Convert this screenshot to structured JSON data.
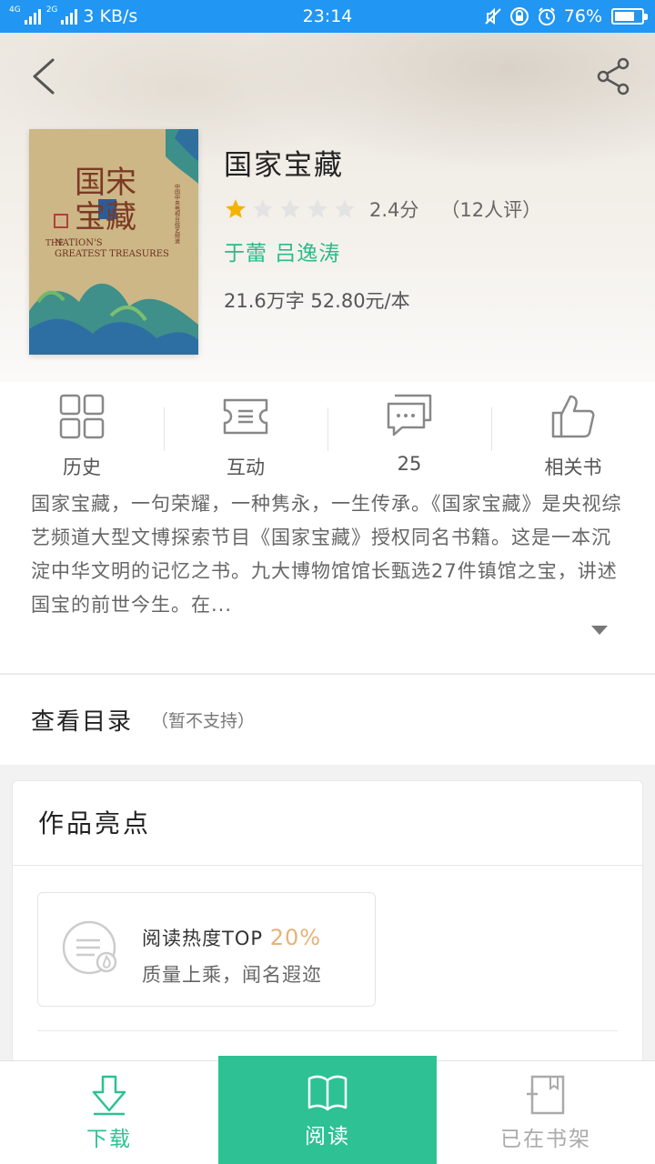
{
  "status_bar": {
    "network_1": "4G",
    "network_2": "2G",
    "speed": "3 KB/s",
    "time": "23:14",
    "battery": "76%",
    "battery_level": 0.76
  },
  "header": {
    "back_icon": "chevron-left-icon",
    "share_icon": "share-icon"
  },
  "book": {
    "cover_title_cn": "国家宝藏",
    "cover_title_en": "NATION'S GREATEST TREASURES",
    "title": "国家宝藏",
    "rating_score": "2.4分",
    "rating_stars": 1,
    "rating_max": 5,
    "review_count": "（12人评）",
    "authors": "于蕾 吕逸涛",
    "meta": "21.6万字 52.80元/本"
  },
  "actions": [
    {
      "label": "历史",
      "icon": "grid-icon"
    },
    {
      "label": "互动",
      "icon": "ticket-icon"
    },
    {
      "label": "25",
      "icon": "comment-icon"
    },
    {
      "label": "相关书",
      "icon": "thumbs-up-icon"
    }
  ],
  "intro": {
    "text": "国家宝藏，一句荣耀，一种隽永，一生传承。《国家宝藏》是央视综艺频道大型文博探索节目《国家宝藏》授权同名书籍。这是一本沉淀中华文明的记忆之书。九大博物馆馆长甄选27件镇馆之宝，讲述国宝的前世今生。在..."
  },
  "toc": {
    "title": "查看目录",
    "note": "（暂不支持）"
  },
  "highlights": {
    "title": "作品亮点",
    "card_line1": "阅读热度TOP",
    "card_pct": "20%",
    "card_line2": "质量上乘，闻名遐迩"
  },
  "bottom_bar": {
    "download": "下载",
    "read": "阅读",
    "shelf": "已在书架"
  },
  "colors": {
    "accent": "#2dc193",
    "status_bar": "#2196f3",
    "star": "#f5b300",
    "highlight_pct": "#e5b27a"
  }
}
